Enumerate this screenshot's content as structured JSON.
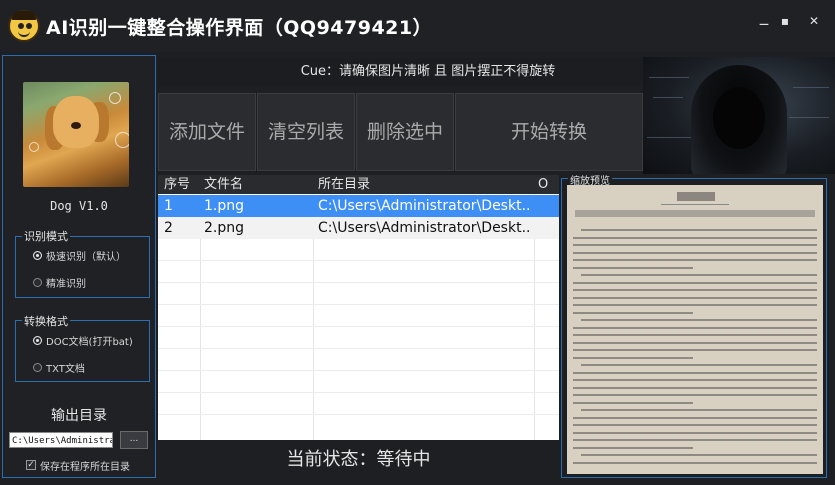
{
  "title": "AI识别一键整合操作界面（QQ9479421）",
  "window_controls": {
    "menu": "⚊",
    "minimize": "▪",
    "close": "✕"
  },
  "left": {
    "version": "Dog V1.0",
    "recognition_group": {
      "title": "识别模式",
      "options": [
        {
          "label": "极速识别（默认）",
          "selected": true
        },
        {
          "label": "精准识别",
          "selected": false
        }
      ]
    },
    "format_group": {
      "title": "转换格式",
      "options": [
        {
          "label": "DOC文档(打开bat)",
          "selected": true
        },
        {
          "label": "TXT文档",
          "selected": false
        }
      ]
    },
    "output_dir_label": "输出目录",
    "output_dir_value": "C:\\Users\\Administra",
    "browse_label": "...",
    "save_in_program_dir": {
      "label": "保存在程序所在目录",
      "checked": true
    }
  },
  "cue": "Cue：请确保图片清晰 且 图片摆正不得旋转",
  "actions": {
    "add": "添加文件",
    "clear": "清空列表",
    "delete": "删除选中",
    "start": "开始转换"
  },
  "table": {
    "headers": [
      "序号",
      "文件名",
      "所在目录",
      "O"
    ],
    "rows": [
      {
        "index": "1",
        "name": "1.png",
        "dir": "C:\\Users\\Administrator\\Deskt...",
        "selected": true
      },
      {
        "index": "2",
        "name": "2.png",
        "dir": "C:\\Users\\Administrator\\Deskt...",
        "selected": false
      }
    ]
  },
  "status": "当前状态：等待中",
  "preview": {
    "label": "缩放预览",
    "doc_heading": "阅读理解 C"
  },
  "colors": {
    "accent_border": "#2c6fb0",
    "selection": "#3d8ef5",
    "background": "#1e1f23"
  }
}
